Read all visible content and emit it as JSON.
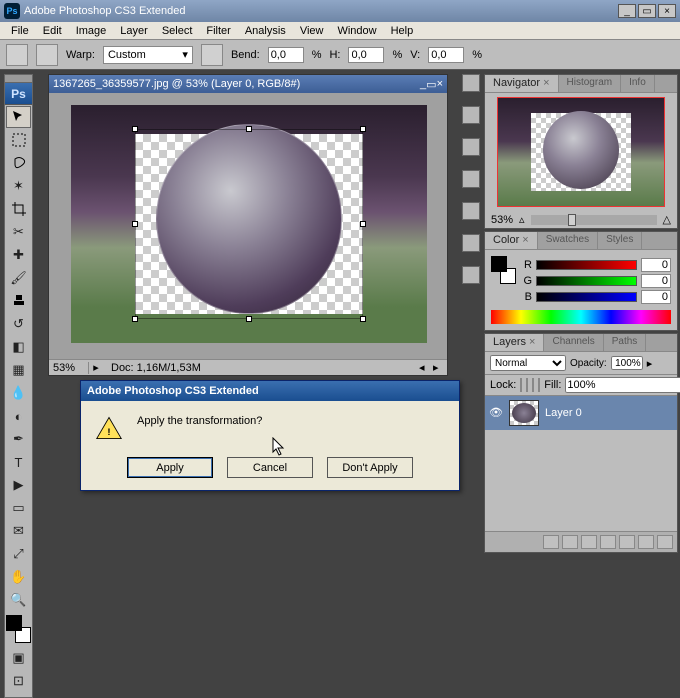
{
  "app": {
    "title": "Adobe Photoshop CS3 Extended"
  },
  "menu": [
    "File",
    "Edit",
    "Image",
    "Layer",
    "Select",
    "Filter",
    "Analysis",
    "View",
    "Window",
    "Help"
  ],
  "options": {
    "warp_label": "Warp:",
    "warp_value": "Custom",
    "bend_label": "Bend:",
    "bend_value": "0,0",
    "bend_pct": "%",
    "h_label": "H:",
    "h_value": "0,0",
    "h_pct": "%",
    "v_label": "V:",
    "v_value": "0,0",
    "v_pct": "%"
  },
  "document": {
    "title": "1367265_36359577.jpg @ 53% (Layer 0, RGB/8#)",
    "zoom": "53%",
    "status": "Doc: 1,16M/1,53M"
  },
  "dialog": {
    "title": "Adobe Photoshop CS3 Extended",
    "message": "Apply the transformation?",
    "apply": "Apply",
    "cancel": "Cancel",
    "dont_apply": "Don't Apply"
  },
  "panels": {
    "navigator": {
      "tabs": [
        "Navigator",
        "Histogram",
        "Info"
      ],
      "zoom": "53%"
    },
    "color": {
      "tabs": [
        "Color",
        "Swatches",
        "Styles"
      ],
      "channels": [
        {
          "label": "R",
          "value": "0"
        },
        {
          "label": "G",
          "value": "0"
        },
        {
          "label": "B",
          "value": "0"
        }
      ]
    },
    "layers": {
      "tabs": [
        "Layers",
        "Channels",
        "Paths"
      ],
      "blend": "Normal",
      "opacity_label": "Opacity:",
      "opacity": "100%",
      "lock_label": "Lock:",
      "fill_label": "Fill:",
      "fill": "100%",
      "layer_name": "Layer 0"
    }
  }
}
